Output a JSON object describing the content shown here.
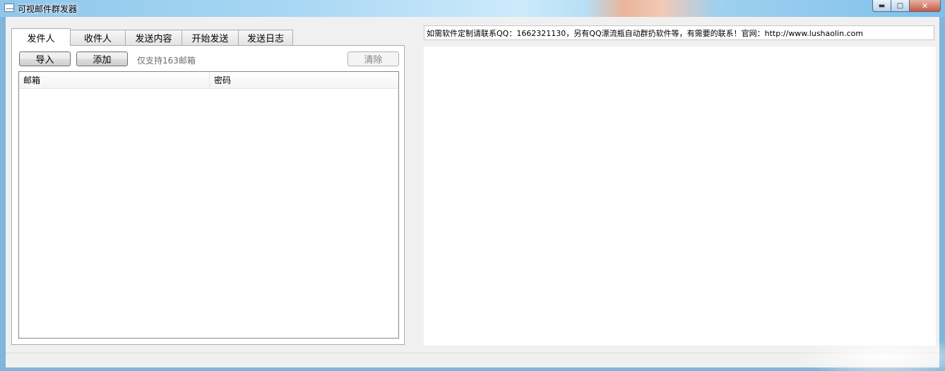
{
  "window": {
    "title": "可视邮件群发器"
  },
  "tabs": [
    {
      "label": "发件人",
      "active": true
    },
    {
      "label": "收件人",
      "active": false
    },
    {
      "label": "发送内容",
      "active": false
    },
    {
      "label": "开始发送",
      "active": false
    },
    {
      "label": "发送日志",
      "active": false
    }
  ],
  "sender_panel": {
    "import_label": "导入",
    "add_label": "添加",
    "hint": "仅支持163邮箱",
    "clear_label": "清除",
    "columns": [
      "邮箱",
      "密码"
    ],
    "rows": []
  },
  "info": {
    "text": "如需软件定制请联系QQ：1662321130，另有QQ漂流瓶自动群扔软件等，有需要的联系！官网：http://www.lushaolin.com"
  },
  "icons": {
    "app": "mail-icon",
    "minimize": "minimize-icon",
    "maximize": "maximize-icon",
    "close": "close-icon"
  }
}
